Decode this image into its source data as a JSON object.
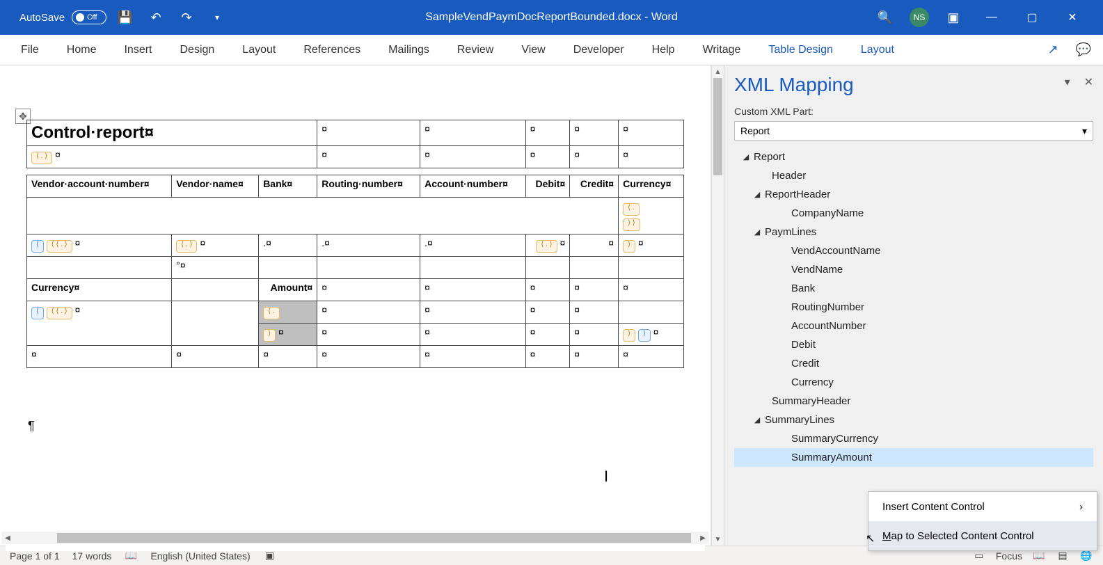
{
  "titlebar": {
    "autosave_label": "AutoSave",
    "autosave_state": "Off",
    "doc_title": "SampleVendPaymDocReportBounded.docx  -  Word",
    "user_initials": "NS"
  },
  "ribbon": {
    "tabs": [
      "File",
      "Home",
      "Insert",
      "Design",
      "Layout",
      "References",
      "Mailings",
      "Review",
      "View",
      "Developer",
      "Help",
      "Writage"
    ],
    "ctx_tabs": [
      "Table Design",
      "Layout"
    ]
  },
  "pane": {
    "title": "XML Mapping",
    "label": "Custom XML Part:",
    "select_value": "Report",
    "tree": {
      "root": "Report",
      "header": "Header",
      "reportHeader": "ReportHeader",
      "companyName": "CompanyName",
      "paymLines": "PaymLines",
      "vendAccountName": "VendAccountName",
      "vendName": "VendName",
      "bank": "Bank",
      "routingNumber": "RoutingNumber",
      "accountNumber": "AccountNumber",
      "debit": "Debit",
      "credit": "Credit",
      "currency": "Currency",
      "summaryHeader": "SummaryHeader",
      "summaryLines": "SummaryLines",
      "summaryCurrency": "SummaryCurrency",
      "summaryAmount": "SummaryAmount"
    }
  },
  "ctx_menu": {
    "insert_pre": "",
    "insert_u": "I",
    "insert_post": "nsert Content Control",
    "map_pre": "",
    "map_u": "M",
    "map_post": "ap to Selected Content Control"
  },
  "document": {
    "title": "Control·report¤",
    "cols": {
      "vendAccount": "Vendor·account·number¤",
      "vendName": "Vendor·name¤",
      "bank": "Bank¤",
      "routing": "Routing·number¤",
      "account": "Account·number¤",
      "debit": "Debit¤",
      "credit": "Credit¤",
      "currency": "Currency¤",
      "currency2": "Currency¤",
      "amount": "Amount¤"
    }
  },
  "status": {
    "page": "Page 1 of 1",
    "words": "17 words",
    "lang": "English (United States)",
    "focus": "Focus"
  }
}
